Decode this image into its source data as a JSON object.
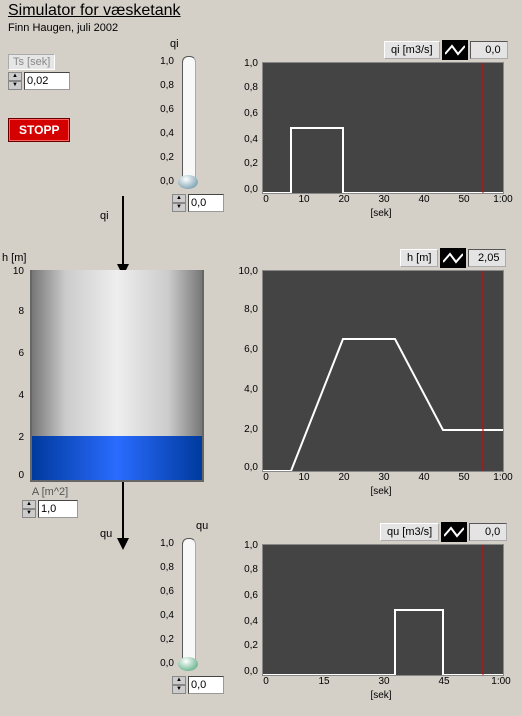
{
  "title": "Simulator for væsketank",
  "subtitle": "Finn Haugen, juli 2002",
  "ts": {
    "label": "Ts [sek]",
    "value": "0,02"
  },
  "stop_label": "STOPP",
  "slider_qi": {
    "label": "qi",
    "value": "0,0",
    "ticks": [
      "1,0",
      "0,8",
      "0,6",
      "0,4",
      "0,2",
      "0,0"
    ]
  },
  "slider_qu": {
    "label": "qu",
    "value": "0,0",
    "ticks": [
      "1,0",
      "0,8",
      "0,6",
      "0,4",
      "0,2",
      "0,0"
    ]
  },
  "arrow_qi_label": "qi",
  "arrow_qu_label": "qu",
  "tank": {
    "h_label": "h [m]",
    "scale": [
      "10",
      "8",
      "6",
      "4",
      "2",
      "0"
    ],
    "a_label": "A [m^2]",
    "a_value": "1,0"
  },
  "charts": {
    "xlabel": "[sek]",
    "qi": {
      "hdr": "qi [m3/s]",
      "val": "0,0",
      "yticks": [
        "1,0",
        "0,8",
        "0,6",
        "0,4",
        "0,2",
        "0,0"
      ],
      "xticks": [
        "0",
        "10",
        "20",
        "30",
        "40",
        "50",
        "1:00"
      ]
    },
    "h": {
      "hdr": "h [m]",
      "val": "2,05",
      "yticks": [
        "10,0",
        "8,0",
        "6,0",
        "4,0",
        "2,0",
        "0,0"
      ],
      "xticks": [
        "0",
        "10",
        "20",
        "30",
        "40",
        "50",
        "1:00"
      ]
    },
    "qu": {
      "hdr": "qu [m3/s]",
      "val": "0,0",
      "yticks": [
        "1,0",
        "0,8",
        "0,6",
        "0,4",
        "0,2",
        "0,0"
      ],
      "xticks": [
        "0",
        "15",
        "30",
        "45",
        "1:00"
      ]
    }
  },
  "chart_data": [
    {
      "type": "line",
      "title": "qi [m3/s]",
      "xlabel": "[sek]",
      "ylabel": "qi",
      "x": [
        0,
        7,
        7,
        20,
        20,
        60
      ],
      "y": [
        0,
        0,
        0.5,
        0.5,
        0,
        0
      ],
      "xlim": [
        0,
        60
      ],
      "ylim": [
        0,
        1
      ],
      "marker_x": 55
    },
    {
      "type": "line",
      "title": "h [m]",
      "xlabel": "[sek]",
      "ylabel": "h",
      "x": [
        0,
        7,
        20,
        33,
        45,
        60
      ],
      "y": [
        0,
        0,
        6.6,
        6.6,
        2.05,
        2.05
      ],
      "xlim": [
        0,
        60
      ],
      "ylim": [
        0,
        10
      ],
      "marker_x": 55
    },
    {
      "type": "line",
      "title": "qu [m3/s]",
      "xlabel": "[sek]",
      "ylabel": "qu",
      "x": [
        0,
        33,
        33,
        45,
        45,
        60
      ],
      "y": [
        0,
        0,
        0.5,
        0.5,
        0,
        0
      ],
      "xlim": [
        0,
        60
      ],
      "ylim": [
        0,
        1
      ],
      "marker_x": 55
    }
  ]
}
